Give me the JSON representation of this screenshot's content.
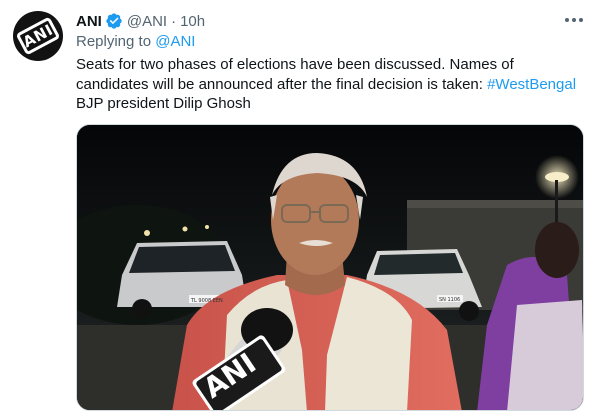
{
  "author": {
    "name": "ANI",
    "handle": "@ANI",
    "separator": "·",
    "time": "10h",
    "avatar_text": "ANI",
    "verified_icon": "verified-badge-icon"
  },
  "reply": {
    "prefix": "Replying to ",
    "mention": "@ANI"
  },
  "tweet": {
    "text_before": "Seats for two phases of elections have been discussed. Names of candidates will be announced after the final decision is taken: ",
    "hashtag": "#WestBengal",
    "text_after": " BJP president Dilip Ghosh"
  },
  "media": {
    "mic_logo_text": "ANI",
    "plate_left": "TL 9008 EEN",
    "plate_right": "SN 1106"
  },
  "colors": {
    "link": "#1d9bf0",
    "secondary_text": "#536471",
    "primary_text": "#0f1419"
  },
  "icons": [
    "more-options-icon",
    "verified-badge-icon"
  ]
}
